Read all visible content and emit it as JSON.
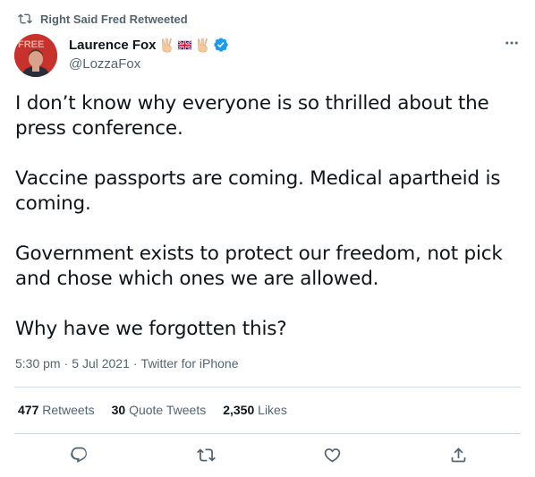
{
  "retweet": {
    "label": "Right Said Fred Retweeted",
    "icon": "retweet-icon"
  },
  "author": {
    "display_name": "Laurence Fox",
    "emojis": [
      "victory-hand-icon",
      "uk-flag-icon",
      "victory-hand-icon"
    ],
    "verified": true,
    "handle": "@LozzaFox"
  },
  "tweet": {
    "paragraphs": [
      "I don’t know why everyone is so thrilled about the press conference.",
      "Vaccine passports are coming. Medical apartheid is coming.",
      "Government exists to protect our freedom, not pick and chose which ones we are allowed.",
      "Why have we forgotten this?"
    ]
  },
  "meta": {
    "time": "5:30 pm",
    "separator": "·",
    "date": "5 Jul 2021",
    "source": "Twitter for iPhone"
  },
  "stats": {
    "retweets_count": "477",
    "retweets_label": "Retweets",
    "quotes_count": "30",
    "quotes_label": "Quote Tweets",
    "likes_count": "2,350",
    "likes_label": "Likes"
  },
  "actions": [
    "reply-icon",
    "retweet-icon",
    "like-icon",
    "share-icon"
  ],
  "colors": {
    "text": "#0f1419",
    "secondary": "#536471",
    "verified": "#1d9bf0",
    "divider": "#cfd9de",
    "avatar_bg": "#c8322c"
  }
}
